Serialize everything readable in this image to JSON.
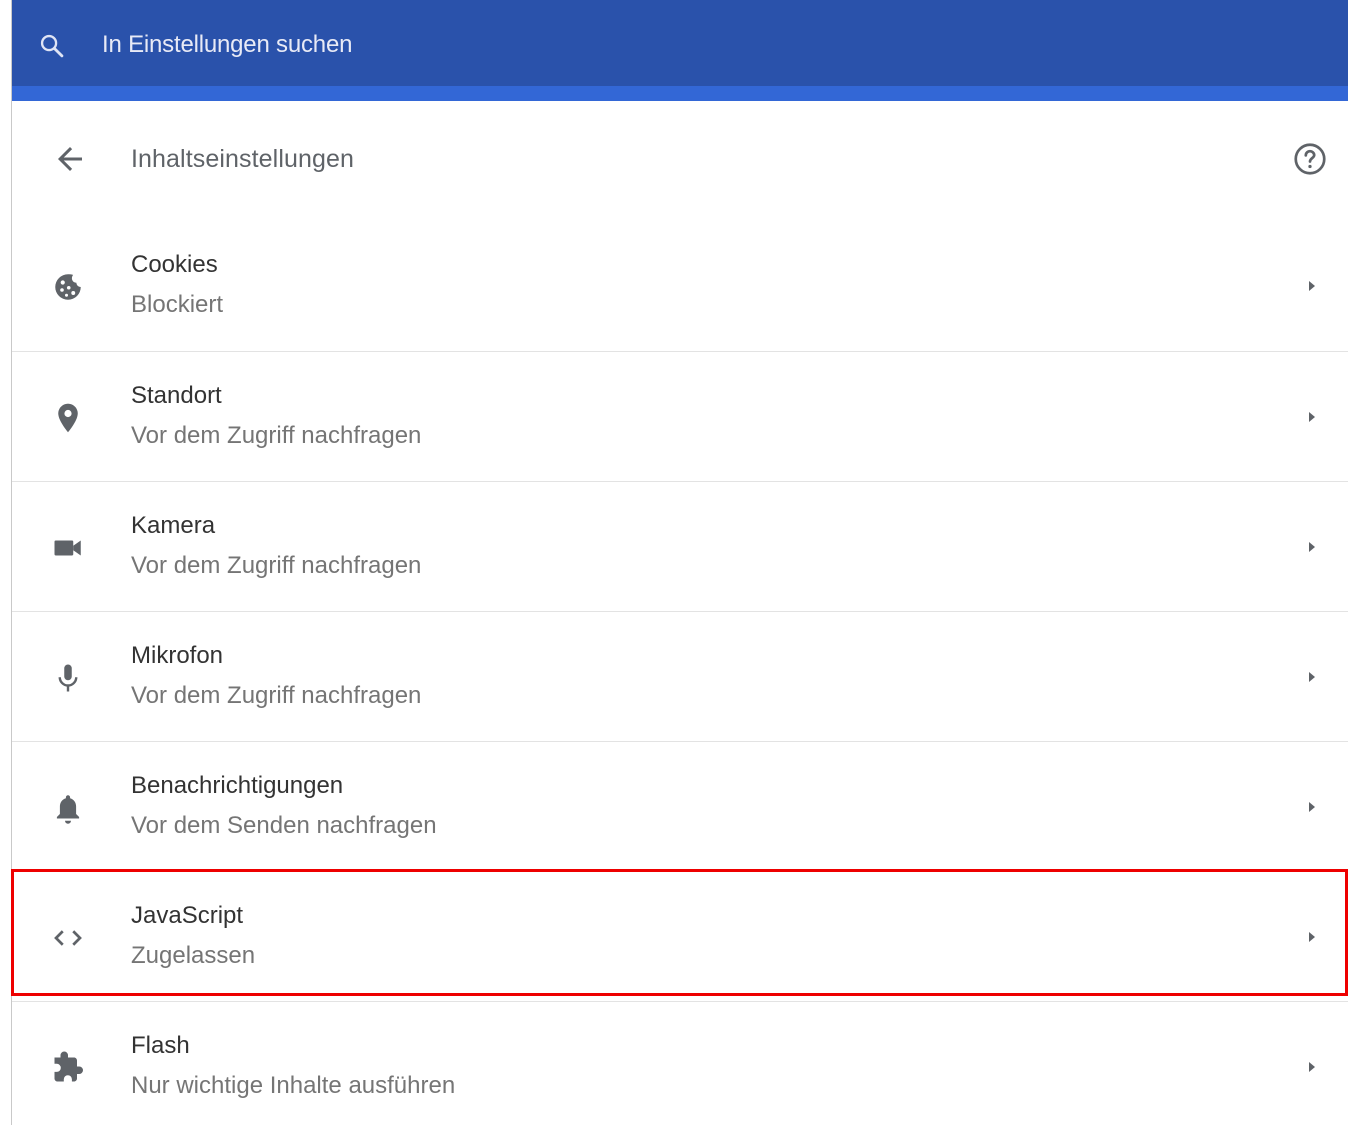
{
  "search": {
    "placeholder": "In Einstellungen suchen",
    "icon": "search-icon"
  },
  "colors": {
    "topbar": "#2a52ab",
    "topbar_accent": "#3367d6",
    "highlight": "#ee0000"
  },
  "header": {
    "title": "Inhaltseinstellungen",
    "back_icon": "arrow-back-icon",
    "help_icon": "help-circle-icon"
  },
  "settings": {
    "items": [
      {
        "label": "Cookies",
        "status": "Blockiert",
        "icon": "cookie-icon"
      },
      {
        "label": "Standort",
        "status": "Vor dem Zugriff nachfragen",
        "icon": "location-pin-icon"
      },
      {
        "label": "Kamera",
        "status": "Vor dem Zugriff nachfragen",
        "icon": "camera-icon"
      },
      {
        "label": "Mikrofon",
        "status": "Vor dem Zugriff nachfragen",
        "icon": "microphone-icon"
      },
      {
        "label": "Benachrichtigungen",
        "status": "Vor dem Senden nachfragen",
        "icon": "bell-icon"
      },
      {
        "label": "JavaScript",
        "status": "Zugelassen",
        "icon": "code-brackets-icon",
        "highlighted": true
      },
      {
        "label": "Flash",
        "status": "Nur wichtige Inhalte ausführen",
        "icon": "puzzle-piece-icon"
      }
    ]
  }
}
